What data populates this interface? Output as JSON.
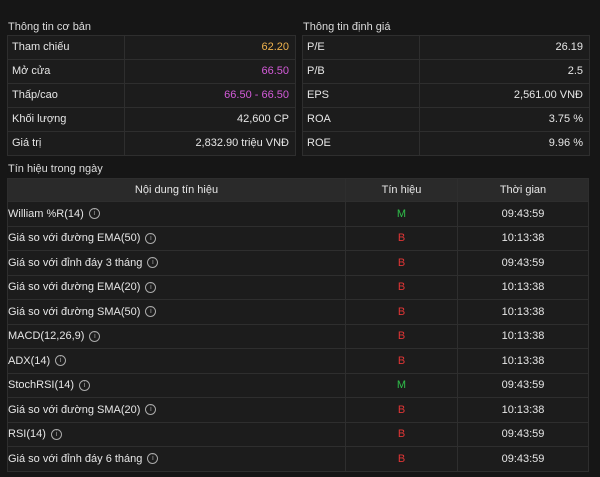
{
  "basic": {
    "title": "Thông tin cơ bản",
    "rows": [
      {
        "label": "Tham chiếu",
        "value": "62.20"
      },
      {
        "label": "Mở cửa",
        "value": "66.50"
      },
      {
        "label": "Thấp/cao",
        "value": "66.50 - 66.50"
      },
      {
        "label": "Khối lượng",
        "value": "42,600 CP"
      },
      {
        "label": "Giá trị",
        "value": "2,832.90 triệu VNĐ"
      }
    ]
  },
  "valuation": {
    "title": "Thông tin định giá",
    "rows": [
      {
        "label": "P/E",
        "value": "26.19"
      },
      {
        "label": "P/B",
        "value": "2.5"
      },
      {
        "label": "EPS",
        "value": "2,561.00 VNĐ"
      },
      {
        "label": "ROA",
        "value": "3.75 %"
      },
      {
        "label": "ROE",
        "value": "9.96 %"
      }
    ]
  },
  "signals": {
    "title": "Tín hiệu trong ngày",
    "headers": [
      "Nội dung tín hiệu",
      "Tín hiệu",
      "Thời gian"
    ],
    "info_icon_glyph": "i",
    "rows": [
      {
        "name": "William %R(14)",
        "signal": "M",
        "time": "09:43:59"
      },
      {
        "name": "Giá so với đường EMA(50)",
        "signal": "B",
        "time": "10:13:38"
      },
      {
        "name": "Giá so với đỉnh đáy 3 tháng",
        "signal": "B",
        "time": "09:43:59"
      },
      {
        "name": "Giá so với đường EMA(20)",
        "signal": "B",
        "time": "10:13:38"
      },
      {
        "name": "Giá so với đường SMA(50)",
        "signal": "B",
        "time": "10:13:38"
      },
      {
        "name": "MACD(12,26,9)",
        "signal": "B",
        "time": "10:13:38"
      },
      {
        "name": "ADX(14)",
        "signal": "B",
        "time": "10:13:38"
      },
      {
        "name": "StochRSI(14)",
        "signal": "M",
        "time": "09:43:59"
      },
      {
        "name": "Giá so với đường SMA(20)",
        "signal": "B",
        "time": "10:13:38"
      },
      {
        "name": "RSI(14)",
        "signal": "B",
        "time": "09:43:59"
      },
      {
        "name": "Giá so với đỉnh đáy 6 tháng",
        "signal": "B",
        "time": "09:43:59"
      }
    ]
  },
  "colors": {
    "background": "#161616",
    "reference_price": "#f0b34d",
    "open_price": "#d35bd8",
    "buy_signal": "#2fbf4a",
    "sell_signal": "#e03535"
  }
}
